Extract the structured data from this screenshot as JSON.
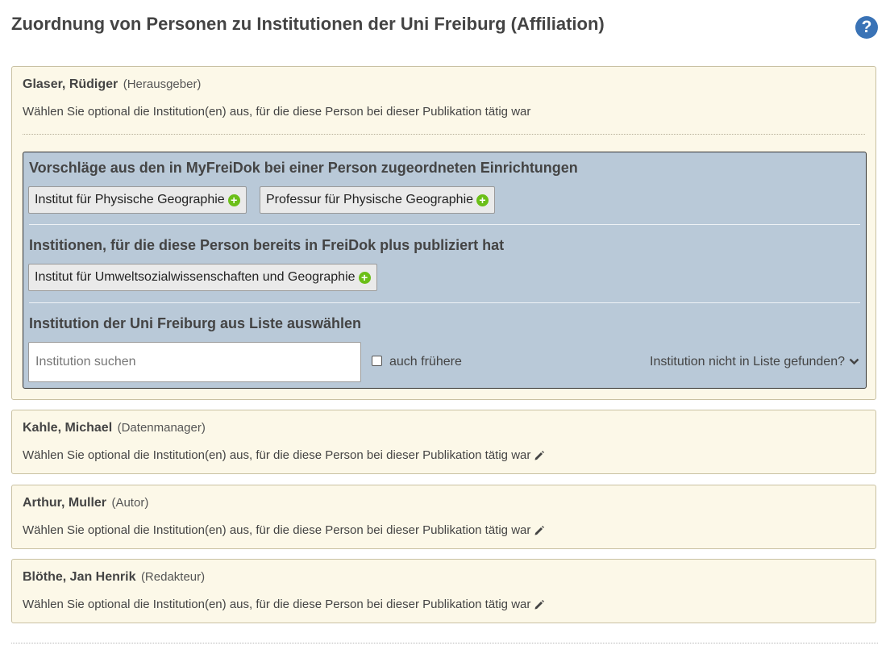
{
  "page": {
    "title": "Zuordnung von Personen zu Institutionen der Uni Freiburg (Affiliation)",
    "help_icon": "?"
  },
  "instruction_text": "Wählen Sie optional die Institution(en) aus, für die diese Person bei dieser Publikation tätig war",
  "persons": [
    {
      "name": "Glaser, Rüdiger",
      "role": "(Herausgeber)",
      "expanded": true
    },
    {
      "name": "Kahle, Michael",
      "role": "(Datenmanager)",
      "expanded": false
    },
    {
      "name": "Arthur, Muller",
      "role": "(Autor)",
      "expanded": false
    },
    {
      "name": "Blöthe, Jan Henrik",
      "role": "(Redakteur)",
      "expanded": false
    }
  ],
  "panel": {
    "suggestions_heading": "Vorschläge aus den in MyFreiDok bei einer Person zugeordneten Einrichtungen",
    "suggestions": [
      "Institut für Physische Geographie",
      "Professur für Physische Geographie"
    ],
    "published_heading": "Institionen, für die diese Person bereits in FreiDok plus publiziert hat",
    "published": [
      "Institut für Umweltsozialwissenschaften und Geographie"
    ],
    "list_heading": "Institution der Uni Freiburg aus Liste auswählen",
    "search_placeholder": "Institution suchen",
    "search_value": "",
    "checkbox_label": "auch frühere",
    "checkbox_checked": false,
    "not_found_label": "Institution nicht in Liste gefunden?"
  },
  "icons": {
    "help": "question-circle-icon",
    "add": "plus-circle-icon",
    "edit": "pencil-icon",
    "expand": "chevron-down-icon"
  },
  "colors": {
    "card_bg": "#fcf8e8",
    "panel_bg": "#b9c9d8",
    "help_blue": "#3a73b6",
    "add_green": "#6bbf18"
  }
}
